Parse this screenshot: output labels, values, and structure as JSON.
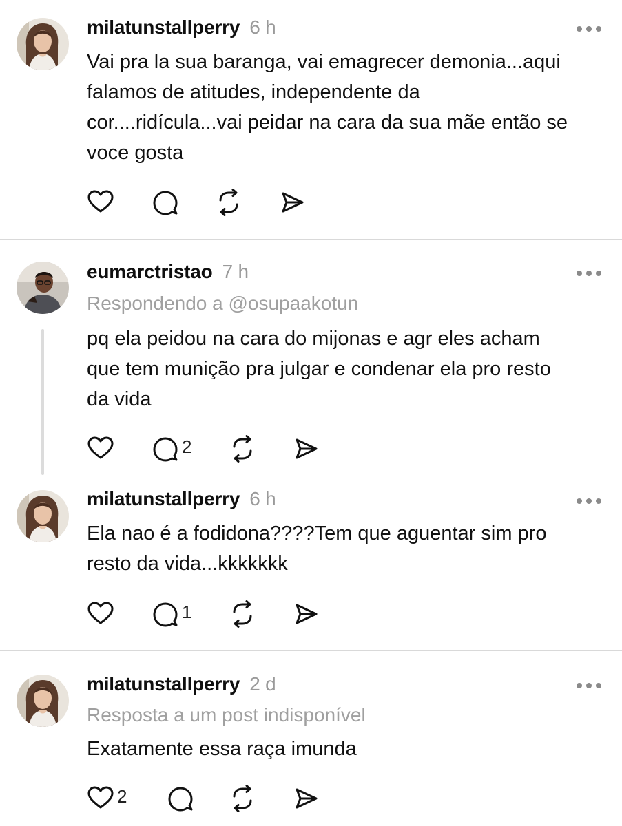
{
  "posts": [
    {
      "username": "milatunstallperry",
      "time": "6 h",
      "subtitle": "",
      "lines": [
        "Vai pra la sua baranga, vai emagrecer demonia...aqui",
        "falamos de atitudes, independente da",
        "cor....ridícula...vai peidar na cara da sua mãe então se",
        "voce gosta"
      ],
      "like_count": "",
      "reply_count": ""
    },
    {
      "username": "eumarctristao",
      "time": "7 h",
      "subtitle": "Respondendo a @osupaakotun",
      "lines": [
        "pq ela peidou na cara do mijonas e agr eles acham",
        "que tem munição pra julgar e condenar ela pro resto",
        "da vida"
      ],
      "like_count": "",
      "reply_count": "2"
    },
    {
      "username": "milatunstallperry",
      "time": "6 h",
      "subtitle": "",
      "lines": [
        "Ela nao é a fodidona????Tem que aguentar sim pro",
        "resto da vida...kkkkkkk"
      ],
      "like_count": "",
      "reply_count": "1"
    },
    {
      "username": "milatunstallperry",
      "time": "2 d",
      "subtitle": "Resposta a um post indisponível",
      "lines": [
        "Exatamente essa raça imunda"
      ],
      "like_count": "2",
      "reply_count": ""
    }
  ],
  "icons": {
    "like": "heart-icon",
    "reply": "comment-icon",
    "repost": "repost-icon",
    "share": "send-icon",
    "more": "more-options-icon"
  },
  "colors": {
    "text": "#111111",
    "muted": "#9a9a9a",
    "divider": "#d9d9d9"
  }
}
